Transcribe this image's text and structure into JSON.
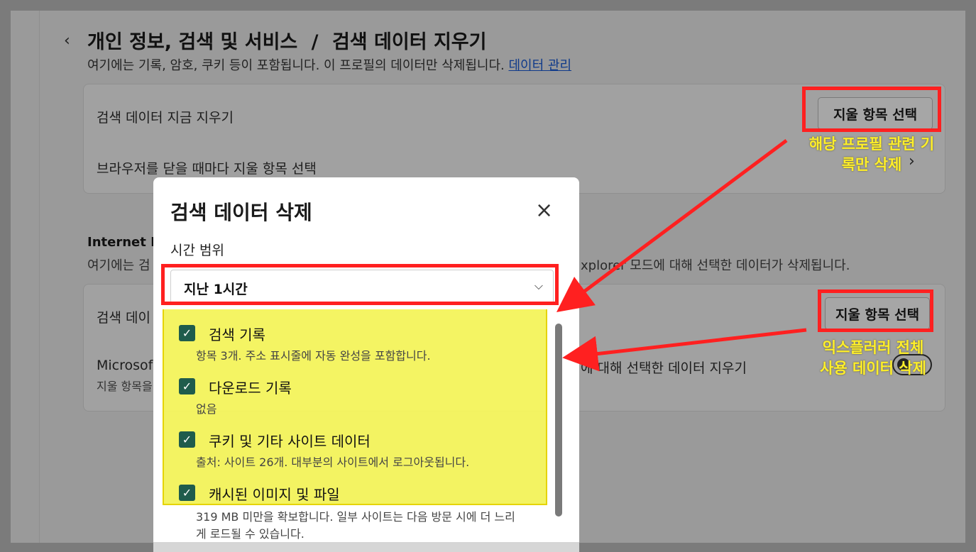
{
  "settings": {
    "breadcrumb_parent": "개인 정보, 검색 및 서비스",
    "breadcrumb_sep": "/",
    "breadcrumb_current": "검색 데이터 지우기",
    "description": "여기에는 기록, 암호, 쿠키 등이 포함됩니다. 이 프로필의 데이터만 삭제됩니다.",
    "manage_link": "데이터 관리",
    "clear_now_label": "검색 데이터 지금 지우기",
    "choose_button": "지울 항목 선택",
    "on_close_label": "브라우저를 닫을 때마다 지울 항목 선택",
    "ie_section_title": "Internet E",
    "ie_desc_left": "여기에는 검",
    "ie_desc_right": "xplorer 모드에 대해 선택한 데이터가 삭제됩니다.",
    "ie_clear_now_label": "검색 데이",
    "ie_choose_button": "지울 항목 선택",
    "ie_close_left": "Microsof",
    "ie_close_right": "에 대해 선택한 데이터 지우기",
    "ie_close_sub": "지울 항목을"
  },
  "dialog": {
    "title": "검색 데이터 삭제",
    "close_icon": "×",
    "range_label": "시간 범위",
    "range_value": "지난 1시간",
    "range_chevron": "⌵",
    "options": [
      {
        "title": "검색 기록",
        "desc": "항목 3개. 주소 표시줄에 자동 완성을 포함합니다.",
        "checked": true
      },
      {
        "title": "다운로드 기록",
        "desc": "없음",
        "checked": true
      },
      {
        "title": "쿠키 및 기타 사이트 데이터",
        "desc": "출처: 사이트 26개. 대부분의 사이트에서 로그아웃됩니다.",
        "checked": true
      },
      {
        "title": "캐시된 이미지 및 파일",
        "desc": "319 MB 미만을 확보합니다. 일부 사이트는 다음 방문 시에 더 느리",
        "desc2": "게 로드될 수 있습니다.",
        "checked": true
      }
    ],
    "check_glyph": "✓"
  },
  "annotations": {
    "note1_line1": "해당 프로필 관련 기",
    "note1_line2": "록만 삭제",
    "note2_line1": "익스플러러 전체",
    "note2_line2": "사용 데이터 삭제",
    "highlight_color": "#ffff5a",
    "box_color": "#ff2020",
    "text_color": "#ffef2a"
  },
  "icons": {
    "back": "‹",
    "row_chevron": "›"
  }
}
